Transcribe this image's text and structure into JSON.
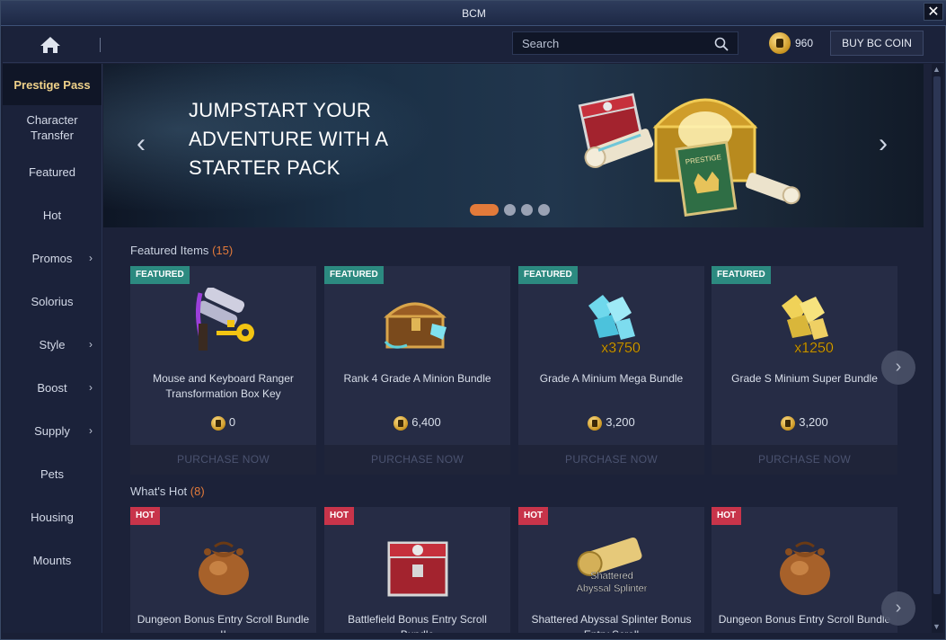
{
  "window": {
    "title": "BCM",
    "close_glyph": "✕"
  },
  "topbar": {
    "home_icon": "home-icon",
    "search": {
      "placeholder": "Search",
      "value": ""
    },
    "coin_balance": "960",
    "buy_label": "BUY BC COIN"
  },
  "sidebar": {
    "items": [
      {
        "label": "Prestige Pass",
        "active": true,
        "chevron": false
      },
      {
        "label": "Character Transfer",
        "active": false,
        "chevron": false
      },
      {
        "label": "Featured",
        "active": false,
        "chevron": false
      },
      {
        "label": "Hot",
        "active": false,
        "chevron": false
      },
      {
        "label": "Promos",
        "active": false,
        "chevron": true
      },
      {
        "label": "Solorius",
        "active": false,
        "chevron": false
      },
      {
        "label": "Style",
        "active": false,
        "chevron": true
      },
      {
        "label": "Boost",
        "active": false,
        "chevron": true
      },
      {
        "label": "Supply",
        "active": false,
        "chevron": true
      },
      {
        "label": "Pets",
        "active": false,
        "chevron": false
      },
      {
        "label": "Housing",
        "active": false,
        "chevron": false
      },
      {
        "label": "Mounts",
        "active": false,
        "chevron": false
      }
    ],
    "chevron_glyph": "›"
  },
  "banner": {
    "title_line1": "JUMPSTART YOUR",
    "title_line2": "ADVENTURE WITH A",
    "title_line3": "STARTER PACK",
    "prev_glyph": "‹",
    "next_glyph": "›",
    "slide_count": 4,
    "active_slide": 1,
    "ticket_label": "PRESTIGE"
  },
  "featured": {
    "title": "Featured Items",
    "count": "(15)",
    "items": [
      {
        "badge": "FEATURED",
        "name": "Mouse and Keyboard Ranger Transformation Box Key",
        "price": "0",
        "action": "PURCHASE NOW",
        "art": "scroll-key-icon"
      },
      {
        "badge": "FEATURED",
        "name": "Rank 4 Grade A Minion Bundle",
        "price": "6,400",
        "action": "PURCHASE NOW",
        "art": "treasure-chest-icon"
      },
      {
        "badge": "FEATURED",
        "name": "Grade A Minium Mega Bundle",
        "price": "3,200",
        "action": "PURCHASE NOW",
        "art": "blue-crystal-icon",
        "overlay": "x3750"
      },
      {
        "badge": "FEATURED",
        "name": "Grade S Minium Super Bundle",
        "price": "3,200",
        "action": "PURCHASE NOW",
        "art": "gold-crystal-icon",
        "overlay": "x1250"
      }
    ]
  },
  "hot": {
    "title": "What's Hot",
    "count": "(8)",
    "items": [
      {
        "badge": "HOT",
        "name": "Dungeon Bonus Entry Scroll Bundle II",
        "art": "pouch-icon"
      },
      {
        "badge": "HOT",
        "name": "Battlefield Bonus Entry Scroll Bundle",
        "art": "red-box-icon"
      },
      {
        "badge": "HOT",
        "name": "Shattered Abyssal Splinter Bonus Entry Scroll",
        "art": "scroll-icon",
        "overlay_line1": "Shattered",
        "overlay_line2": "Abyssal Splinter"
      },
      {
        "badge": "HOT",
        "name": "Dungeon Bonus Entry Scroll Bundle",
        "art": "pouch-icon"
      }
    ]
  },
  "carousel_next_glyph": "›",
  "colors": {
    "accent": "#e27a3a",
    "featured_badge": "#2c8a80",
    "hot_badge": "#c8344a",
    "active_nav": "#f0d28a"
  }
}
